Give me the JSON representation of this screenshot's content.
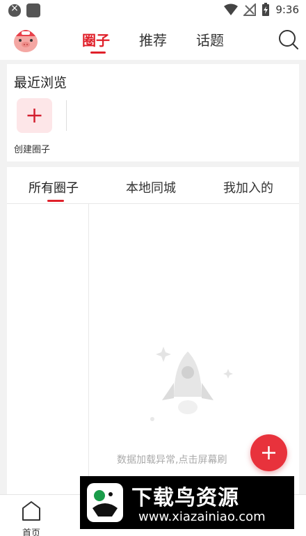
{
  "status_bar": {
    "time": "9:36"
  },
  "header": {
    "tabs": [
      {
        "label": "圈子",
        "active": true
      },
      {
        "label": "推荐",
        "active": false
      },
      {
        "label": "话题",
        "active": false
      }
    ],
    "accent_color": "#e0202a"
  },
  "recent": {
    "title": "最近浏览",
    "create_label": "创建圈子"
  },
  "circles": {
    "tabs": [
      {
        "label": "所有圈子",
        "active": true
      },
      {
        "label": "本地同城",
        "active": false
      },
      {
        "label": "我加入的",
        "active": false
      }
    ],
    "empty_message": "数据加载异常,点击屏幕刷"
  },
  "bottom_nav": {
    "items": [
      {
        "label": "首页",
        "icon": "home-icon"
      }
    ]
  },
  "watermark": {
    "title": "下载鸟资源",
    "url": "www.xiazainiao.com"
  }
}
